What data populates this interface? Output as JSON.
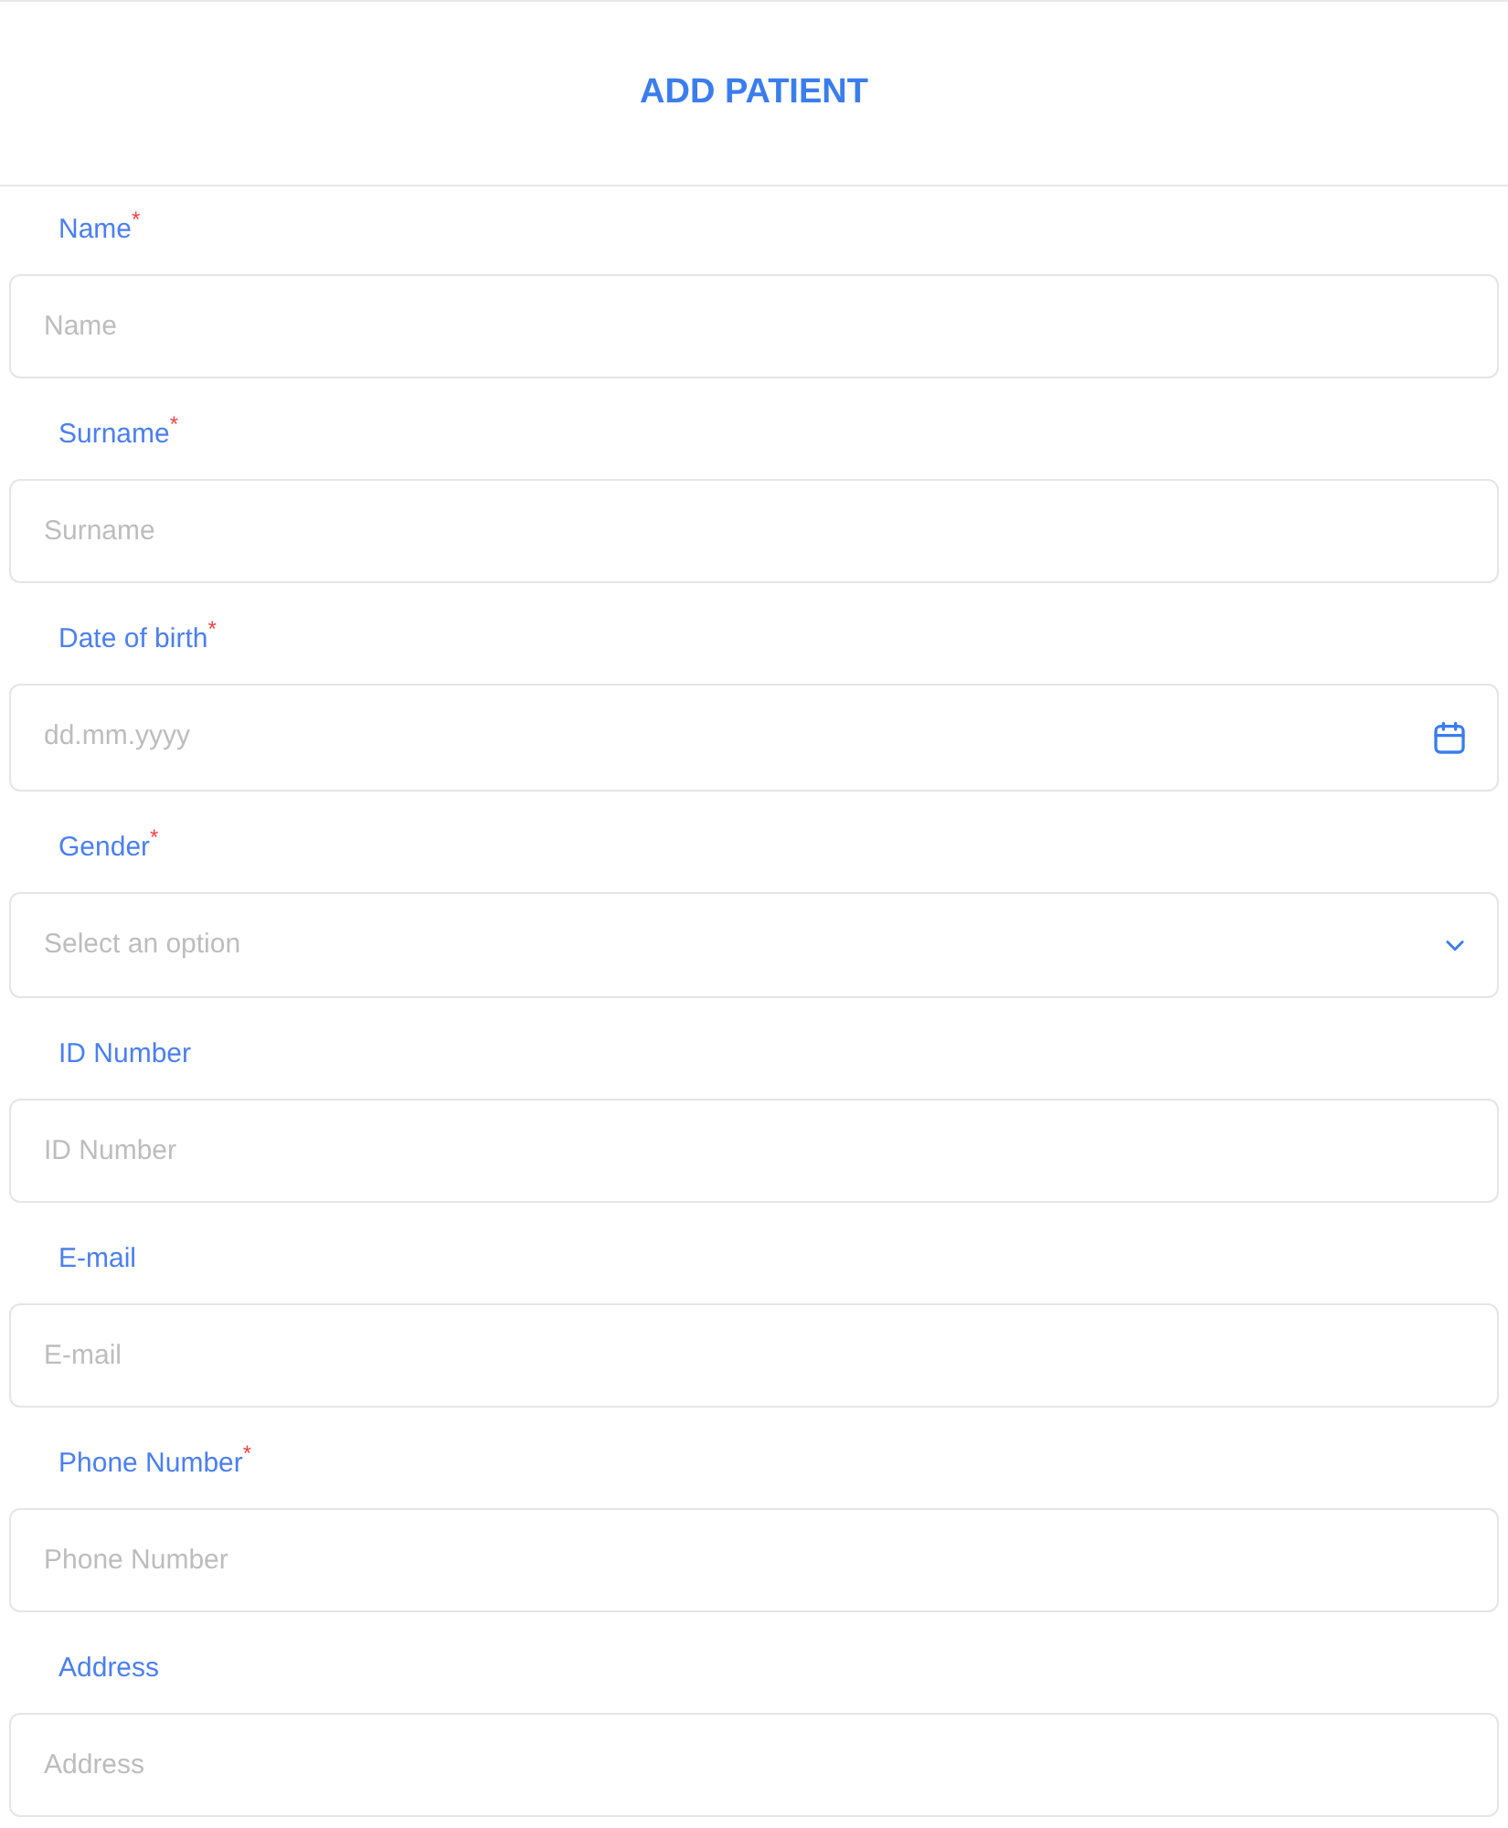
{
  "title": "ADD PATIENT",
  "fields": [
    {
      "kind": "text",
      "label": "Name",
      "required_mark": "*",
      "placeholder": "Name"
    },
    {
      "kind": "text",
      "label": "Surname",
      "required_mark": "*",
      "placeholder": "Surname"
    },
    {
      "kind": "date",
      "label": "Date of birth",
      "required_mark": "*",
      "placeholder": "dd.mm.yyyy"
    },
    {
      "kind": "select",
      "label": "Gender",
      "required_mark": "*",
      "placeholder": "Select an option"
    },
    {
      "kind": "text",
      "label": "ID Number",
      "placeholder": "ID Number"
    },
    {
      "kind": "text",
      "label": "E-mail",
      "placeholder": "E-mail"
    },
    {
      "kind": "text",
      "label": "Phone Number",
      "required_mark": "*",
      "placeholder": "Phone Number"
    },
    {
      "kind": "text",
      "label": "Address",
      "placeholder": "Address"
    }
  ]
}
